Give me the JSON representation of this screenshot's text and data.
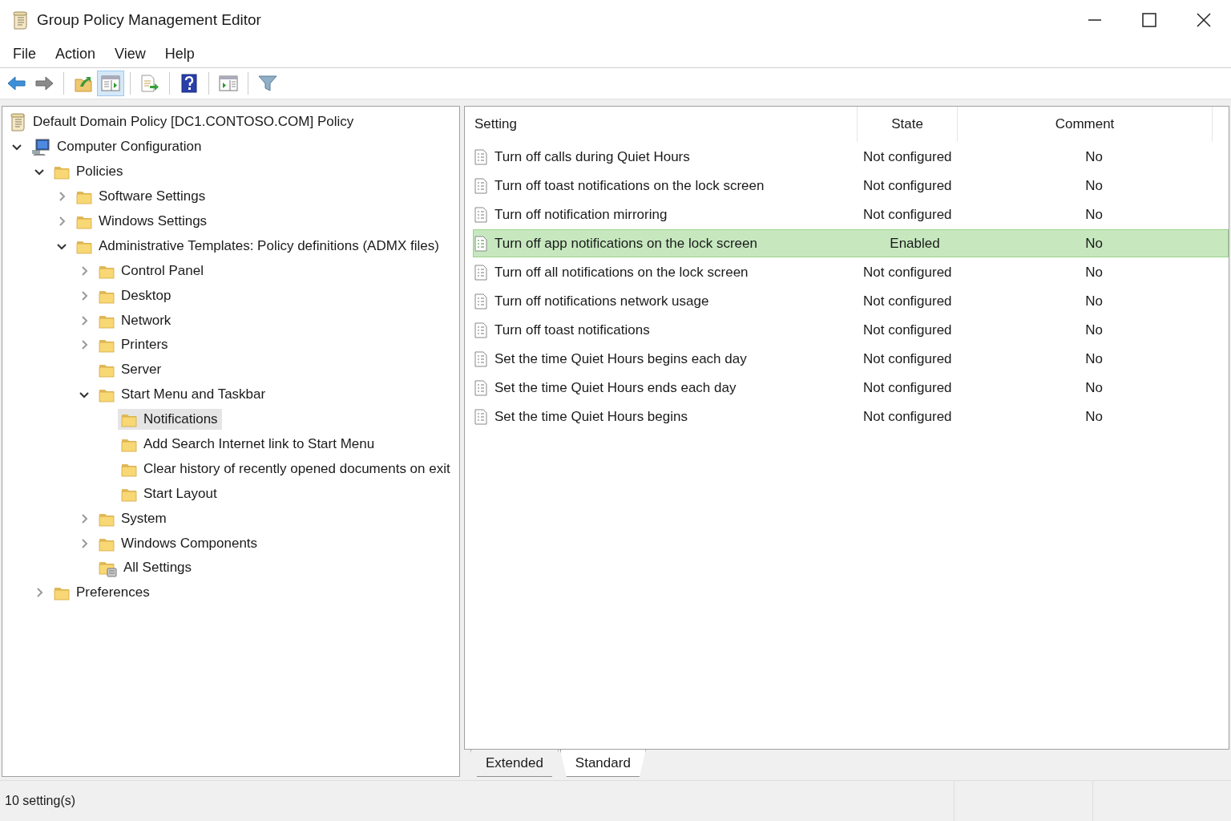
{
  "window": {
    "title": "Group Policy Management Editor"
  },
  "menu": [
    "File",
    "Action",
    "View",
    "Help"
  ],
  "toolbar": [
    {
      "kind": "back",
      "pressed": false
    },
    {
      "kind": "forward",
      "pressed": false
    },
    {
      "kind": "sep"
    },
    {
      "kind": "up",
      "pressed": false
    },
    {
      "kind": "tree",
      "pressed": true
    },
    {
      "kind": "sep"
    },
    {
      "kind": "export",
      "pressed": false
    },
    {
      "kind": "sep"
    },
    {
      "kind": "help",
      "pressed": false
    },
    {
      "kind": "sep"
    },
    {
      "kind": "pane",
      "pressed": false
    },
    {
      "kind": "sep"
    },
    {
      "kind": "filter",
      "pressed": false
    }
  ],
  "tree": {
    "root": {
      "label": "Default Domain Policy [DC1.CONTOSO.COM] Policy",
      "selected": false
    },
    "items": [
      {
        "label": "Computer Configuration",
        "kind": "computer",
        "expanded": true,
        "selected": false,
        "children": [
          {
            "label": "Policies",
            "kind": "folder",
            "expanded": true,
            "selected": false,
            "children": [
              {
                "label": "Software Settings",
                "kind": "folder",
                "expanded": false,
                "selected": false
              },
              {
                "label": "Windows Settings",
                "kind": "folder",
                "expanded": false,
                "selected": false
              },
              {
                "label": "Administrative Templates: Policy definitions (ADMX files)",
                "kind": "folder",
                "expanded": true,
                "selected": false,
                "children": [
                  {
                    "label": "Control Panel",
                    "kind": "folder",
                    "expanded": false,
                    "selected": false
                  },
                  {
                    "label": "Desktop",
                    "kind": "folder",
                    "expanded": false,
                    "selected": false
                  },
                  {
                    "label": "Network",
                    "kind": "folder",
                    "expanded": false,
                    "selected": false
                  },
                  {
                    "label": "Printers",
                    "kind": "folder",
                    "expanded": false,
                    "selected": false
                  },
                  {
                    "label": "Server",
                    "kind": "folder",
                    "selected": false
                  },
                  {
                    "label": "Start Menu and Taskbar",
                    "kind": "folder",
                    "expanded": true,
                    "selected": false,
                    "children": [
                      {
                        "label": "Notifications",
                        "kind": "folder",
                        "selected": true
                      },
                      {
                        "label": "Add Search Internet link to Start Menu",
                        "kind": "folder",
                        "selected": false
                      },
                      {
                        "label": "Clear history of recently opened documents on exit",
                        "kind": "folder",
                        "selected": false
                      },
                      {
                        "label": "Start Layout",
                        "kind": "folder",
                        "selected": false
                      }
                    ]
                  },
                  {
                    "label": "System",
                    "kind": "folder",
                    "expanded": false,
                    "selected": false
                  },
                  {
                    "label": "Windows Components",
                    "kind": "folder",
                    "expanded": false,
                    "selected": false
                  },
                  {
                    "label": "All Settings",
                    "kind": "allsettings",
                    "selected": false
                  }
                ]
              }
            ]
          },
          {
            "label": "Preferences",
            "kind": "folder",
            "expanded": false,
            "selected": false
          }
        ]
      }
    ]
  },
  "table": {
    "columns": [
      "Setting",
      "State",
      "Comment"
    ],
    "rows": [
      {
        "setting": "Turn off calls during Quiet Hours",
        "state": "Not configured",
        "comment": "No",
        "selected": false
      },
      {
        "setting": "Turn off toast notifications on the lock screen",
        "state": "Not configured",
        "comment": "No",
        "selected": false
      },
      {
        "setting": "Turn off notification mirroring",
        "state": "Not configured",
        "comment": "No",
        "selected": false
      },
      {
        "setting": "Turn off app notifications on the lock screen",
        "state": "Enabled",
        "comment": "No",
        "selected": true
      },
      {
        "setting": "Turn off all notifications on the lock screen",
        "state": "Not configured",
        "comment": "No",
        "selected": false
      },
      {
        "setting": "Turn off notifications network usage",
        "state": "Not configured",
        "comment": "No",
        "selected": false
      },
      {
        "setting": "Turn off toast notifications",
        "state": "Not configured",
        "comment": "No",
        "selected": false
      },
      {
        "setting": "Set the time Quiet Hours begins each day",
        "state": "Not configured",
        "comment": "No",
        "selected": false
      },
      {
        "setting": "Set the time Quiet Hours ends each day",
        "state": "Not configured",
        "comment": "No",
        "selected": false
      },
      {
        "setting": "Set the time Quiet Hours begins",
        "state": "Not configured",
        "comment": "No",
        "selected": false
      }
    ]
  },
  "view_tabs": [
    {
      "label": "Extended",
      "selected": false
    },
    {
      "label": "Standard",
      "selected": true
    }
  ],
  "status_bar": {
    "text": "10 setting(s)"
  }
}
